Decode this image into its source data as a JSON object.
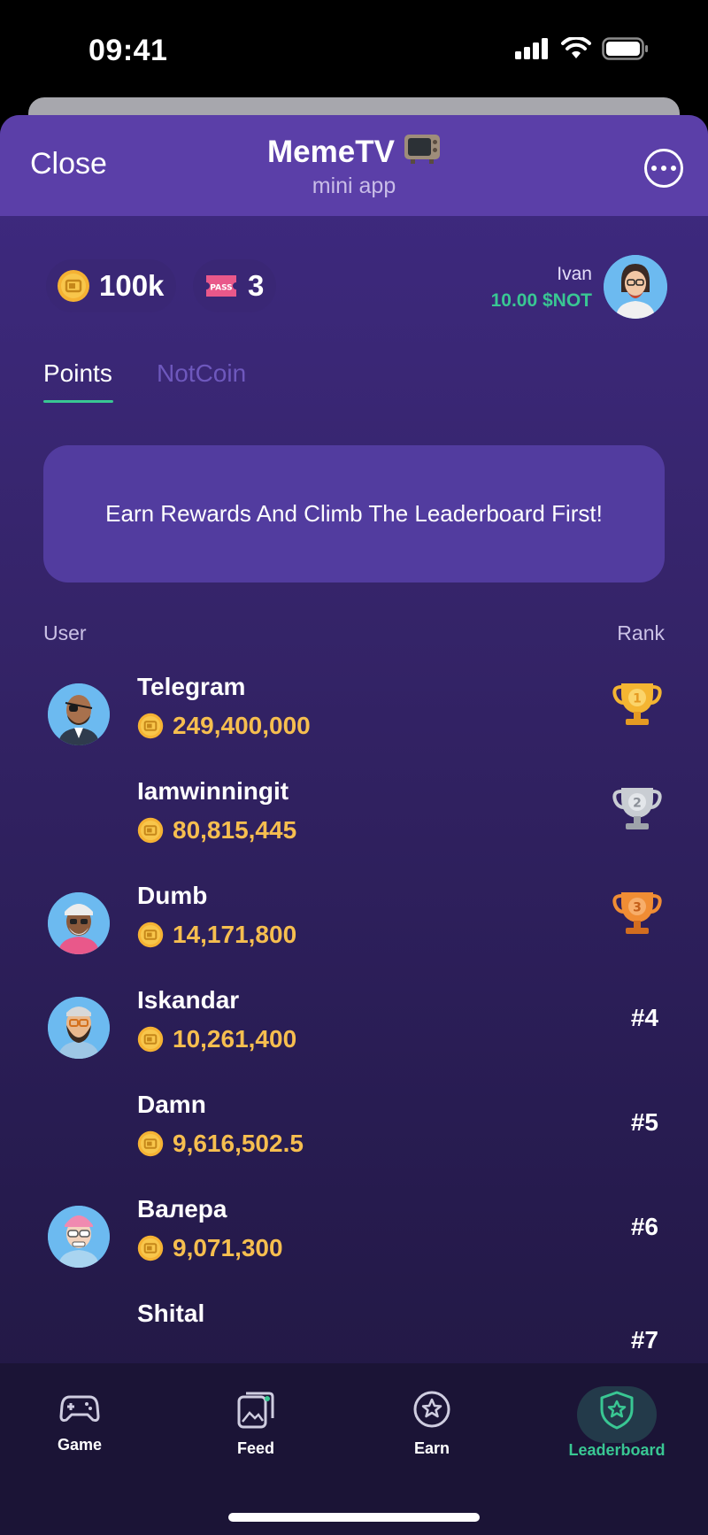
{
  "status_bar": {
    "time": "09:41",
    "icons": [
      "signal-icon",
      "wifi-icon",
      "battery-icon"
    ]
  },
  "header": {
    "close_label": "Close",
    "title": "MemeTV",
    "title_emoji": "tv-icon",
    "subtitle": "mini app",
    "menu_icon": "more-icon"
  },
  "balances": {
    "coins": "100k",
    "passes": "3"
  },
  "user": {
    "name": "Ivan",
    "not_balance": "10.00 $NOT"
  },
  "tabs": [
    {
      "label": "Points",
      "active": true
    },
    {
      "label": "NotCoin",
      "active": false
    }
  ],
  "banner": {
    "text": "Earn Rewards And Climb The Leaderboard First!"
  },
  "columns": {
    "user": "User",
    "rank": "Rank"
  },
  "leaderboard": [
    {
      "name": "Telegram",
      "points": "249,400,000",
      "rank": "1",
      "trophy": "gold",
      "avatar": "eyepatch"
    },
    {
      "name": "Iamwinningit",
      "points": "80,815,445",
      "rank": "2",
      "trophy": "silver",
      "avatar": ""
    },
    {
      "name": "Dumb",
      "points": "14,171,800",
      "rank": "3",
      "trophy": "bronze",
      "avatar": "bandana"
    },
    {
      "name": "Iskandar",
      "points": "10,261,400",
      "rank": "#4",
      "trophy": "",
      "avatar": "beard"
    },
    {
      "name": "Damn",
      "points": "9,616,502.5",
      "rank": "#5",
      "trophy": "",
      "avatar": ""
    },
    {
      "name": "Валера",
      "points": "9,071,300",
      "rank": "#6",
      "trophy": "",
      "avatar": "pink"
    },
    {
      "name": "Shital",
      "points": "",
      "rank": "#7",
      "trophy": "",
      "avatar": ""
    }
  ],
  "nav": [
    {
      "label": "Game",
      "icon": "gamepad-icon",
      "active": false
    },
    {
      "label": "Feed",
      "icon": "feed-icon",
      "active": false
    },
    {
      "label": "Earn",
      "icon": "earn-star-icon",
      "active": false
    },
    {
      "label": "Leaderboard",
      "icon": "shield-star-icon",
      "active": true
    }
  ],
  "colors": {
    "accent": "#39c793",
    "gold_text": "#f6be4f",
    "header_bg": "#5b3fa8",
    "banner_bg": "#523c9f"
  }
}
